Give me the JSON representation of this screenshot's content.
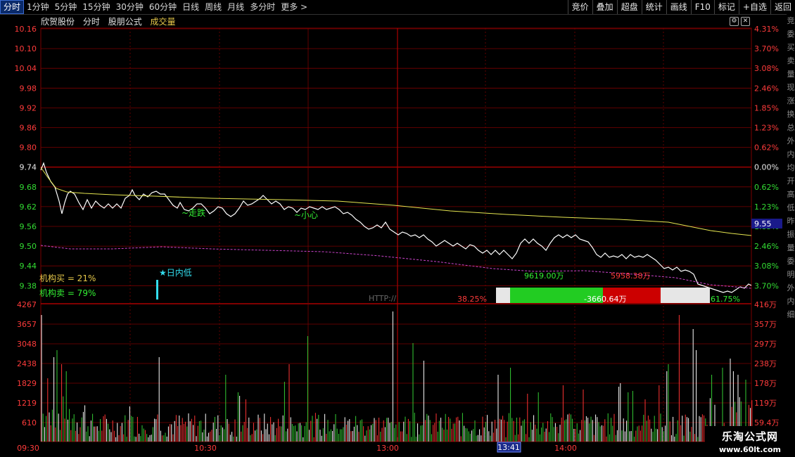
{
  "toolbar": {
    "tabs": [
      "分时",
      "1分钟",
      "5分钟",
      "15分钟",
      "30分钟",
      "60分钟",
      "日线",
      "周线",
      "月线",
      "多分时",
      "更多 >"
    ],
    "tools": [
      "竞价",
      "叠加",
      "超盘",
      "统计",
      "画线",
      "F10",
      "标记",
      "+自选",
      "返回"
    ]
  },
  "header": {
    "stock": "欣贺股份",
    "mode": "分时",
    "formula": "股朋公式",
    "volume_label": "成交量"
  },
  "controls": {
    "gear": "⚙",
    "close": "✕"
  },
  "price_axis": {
    "left": [
      "10.16",
      "10.10",
      "10.04",
      "9.98",
      "9.92",
      "9.86",
      "9.80",
      "9.74",
      "9.68",
      "9.62",
      "9.56",
      "9.50",
      "9.44",
      "9.38"
    ],
    "right": [
      "4.31%",
      "3.70%",
      "3.08%",
      "2.46%",
      "1.85%",
      "1.23%",
      "0.62%",
      "0.00%",
      "0.62%",
      "1.23%",
      "1.85%",
      "2.46%",
      "3.08%",
      "3.70%"
    ],
    "current_price": "9.55"
  },
  "volume_axis": {
    "left": [
      "4267",
      "3657",
      "3048",
      "2438",
      "1829",
      "1219",
      "610"
    ],
    "right": [
      "416万",
      "357万",
      "297万",
      "238万",
      "178万",
      "119万",
      "59.4万"
    ]
  },
  "time_axis": [
    "09:30",
    "10:30",
    "13:00",
    "14:00"
  ],
  "cursor_time": "13:41",
  "annotations": {
    "fall": "~走跌",
    "careful": "~小心",
    "intraday_low": "★日内低",
    "inst_buy": "机构买 = 21%",
    "inst_sell": "机构卖 = 79%",
    "http": "HTTP://",
    "flow_left": "9619.00万",
    "flow_right": "5958.38万",
    "pct_left": "38.25%",
    "flow_center": "-3660.64万",
    "pct_right": "61.75%"
  },
  "colors": {
    "up": "#ff3333",
    "down": "#33cc33",
    "price": "#ffffff",
    "avg": "#e6e650",
    "ma": "#cc44cc",
    "grid": "#7a0000"
  },
  "brand": {
    "name": "乐淘公式网",
    "url": "www.60lt.com"
  },
  "sidebar_chars": [
    "竞",
    "委",
    "买",
    "卖",
    "量",
    "现",
    "涨",
    "换",
    "总",
    "外",
    "内",
    "均",
    "开",
    "高",
    "低",
    "昨",
    "振",
    "量",
    "委",
    "明",
    "外",
    "内",
    "细"
  ]
}
